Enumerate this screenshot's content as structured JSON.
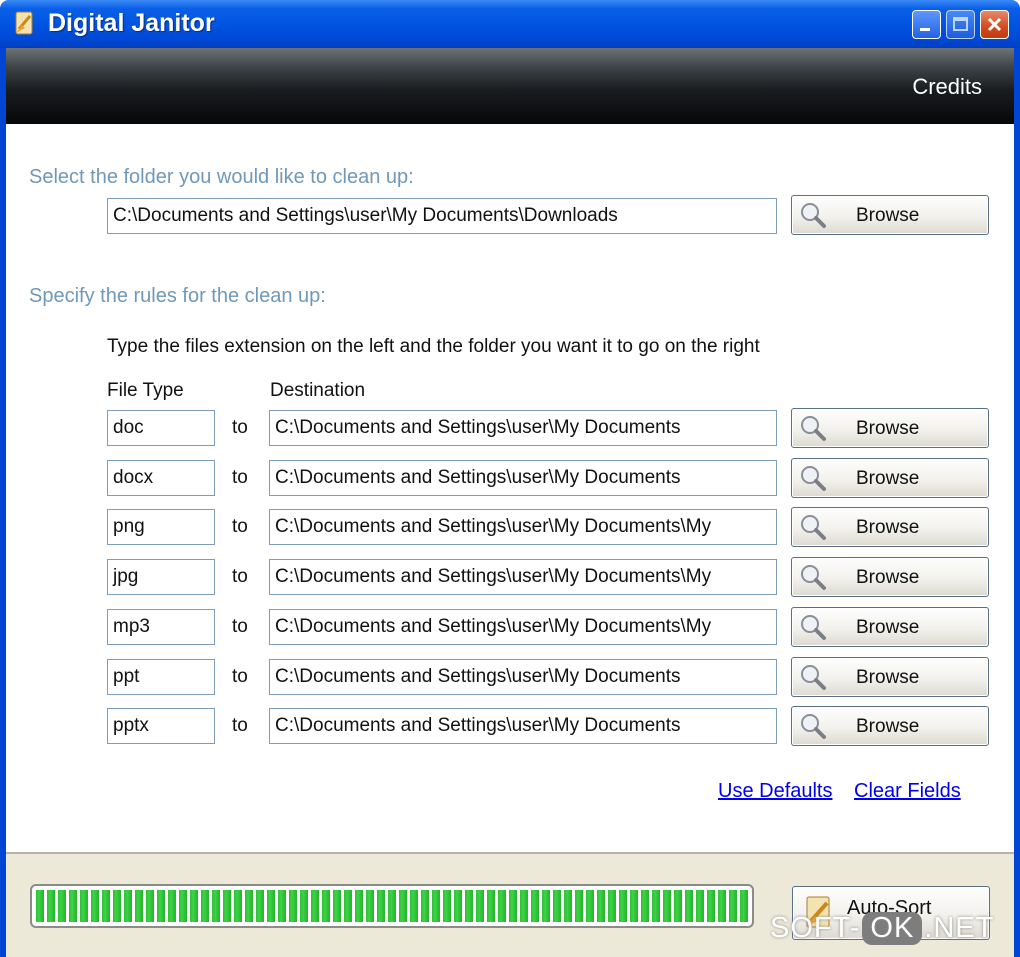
{
  "window": {
    "title": "Digital Janitor"
  },
  "header": {
    "credits_label": "Credits"
  },
  "folder_section": {
    "heading": "Select the folder you would like to clean up:",
    "path": "C:\\Documents and Settings\\user\\My Documents\\Downloads",
    "browse_label": "Browse"
  },
  "rules_section": {
    "heading": "Specify the rules for the clean up:",
    "instructions": "Type the files extension on the left and the folder you want it to go on the right",
    "col_file_type": "File Type",
    "col_destination": "Destination",
    "to_label": "to",
    "browse_label": "Browse",
    "rules": [
      {
        "ext": "doc",
        "dest": "C:\\Documents and Settings\\user\\My Documents"
      },
      {
        "ext": "docx",
        "dest": "C:\\Documents and Settings\\user\\My Documents"
      },
      {
        "ext": "png",
        "dest": "C:\\Documents and Settings\\user\\My Documents\\My"
      },
      {
        "ext": "jpg",
        "dest": "C:\\Documents and Settings\\user\\My Documents\\My"
      },
      {
        "ext": "mp3",
        "dest": "C:\\Documents and Settings\\user\\My Documents\\My"
      },
      {
        "ext": "ppt",
        "dest": "C:\\Documents and Settings\\user\\My Documents"
      },
      {
        "ext": "pptx",
        "dest": "C:\\Documents and Settings\\user\\My Documents"
      }
    ]
  },
  "links": {
    "use_defaults": "Use Defaults",
    "clear_fields": "Clear Fields"
  },
  "footer": {
    "progress": 1.0,
    "autosort_label": "Auto-Sort"
  },
  "watermark": {
    "left": "SOFT-",
    "mid": "OK",
    "right": ".NET"
  },
  "colors": {
    "section_heading": "#6f98b9",
    "link": "#0000ee",
    "progress": "#3bd444"
  }
}
